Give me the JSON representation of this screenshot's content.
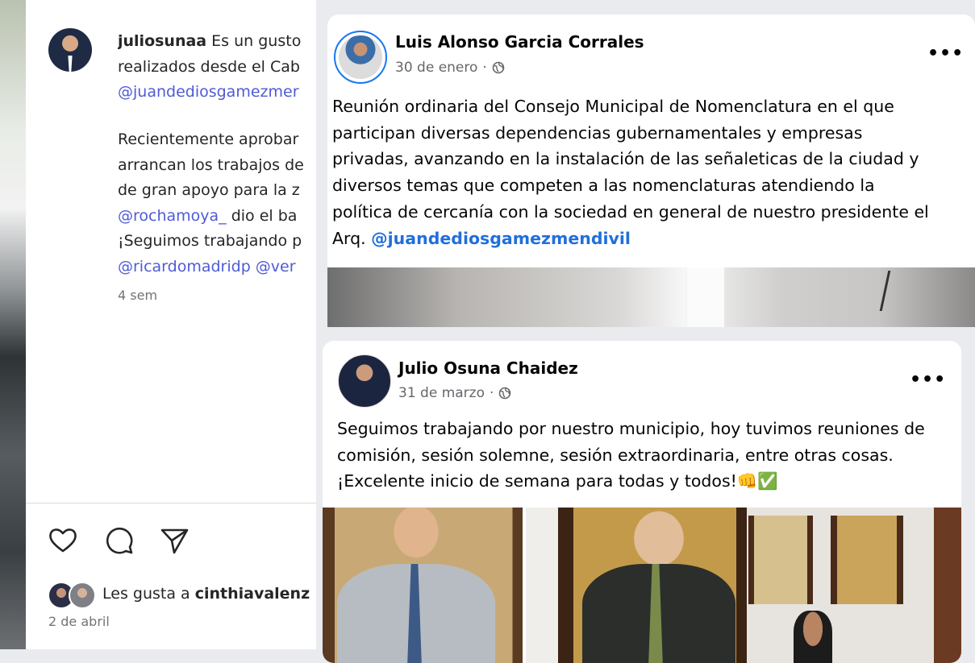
{
  "instagram": {
    "username": "juliosunaa",
    "caption_lines": [
      "Es un gusto",
      "realizados desde el Cab",
      "@juandediosgamezmer"
    ],
    "paragraph_lines": [
      "Recientemente aprobar",
      "arrancan los trabajos de",
      "de gran apoyo para la z",
      "@rochamoya_ dio el ba",
      "¡Seguimos trabajando p",
      "@ricardomadridp @ver"
    ],
    "mention_rochamoya": "@rochamoya_",
    "mention_rochamoya_rest": " dio el ba",
    "mention_ricardo": "@ricardomadridp @ver",
    "time": "4 sem",
    "likes_prefix": "Les gusta a ",
    "likes_user": "cinthiavalenz",
    "date": "2 de abril"
  },
  "post1": {
    "author": "Luis Alonso Garcia Corrales",
    "date": "30 de enero",
    "separator": "·",
    "more": "•••",
    "lines": [
      "Reunión ordinaria del Consejo Municipal de Nomenclatura en el que",
      "participan diversas dependencias gubernamentales y empresas",
      "privadas, avanzando en la instalación de las señaleticas de la ciudad y",
      "diversos temas que competen a las nomenclaturas atendiendo la",
      "política de cercanía con la sociedad en general de nuestro presidente el"
    ],
    "last_prefix": "Arq. ",
    "last_link": "@juandediosgamezmendivil"
  },
  "post2": {
    "author": "Julio Osuna Chaidez",
    "date": "31 de marzo",
    "separator": "·",
    "more": "•••",
    "lines": [
      "Seguimos trabajando por nuestro municipio, hoy tuvimos reuniones de",
      "comisión, sesión solemne, sesión extraordinaria, entre otras cosas.",
      "¡Excelente inicio de semana para todas y todos!👊✅"
    ]
  },
  "icons": {
    "like": "heart-icon",
    "comment": "comment-icon",
    "share": "send-icon",
    "privacy": "globe-icon",
    "options": "more-options-icon"
  }
}
